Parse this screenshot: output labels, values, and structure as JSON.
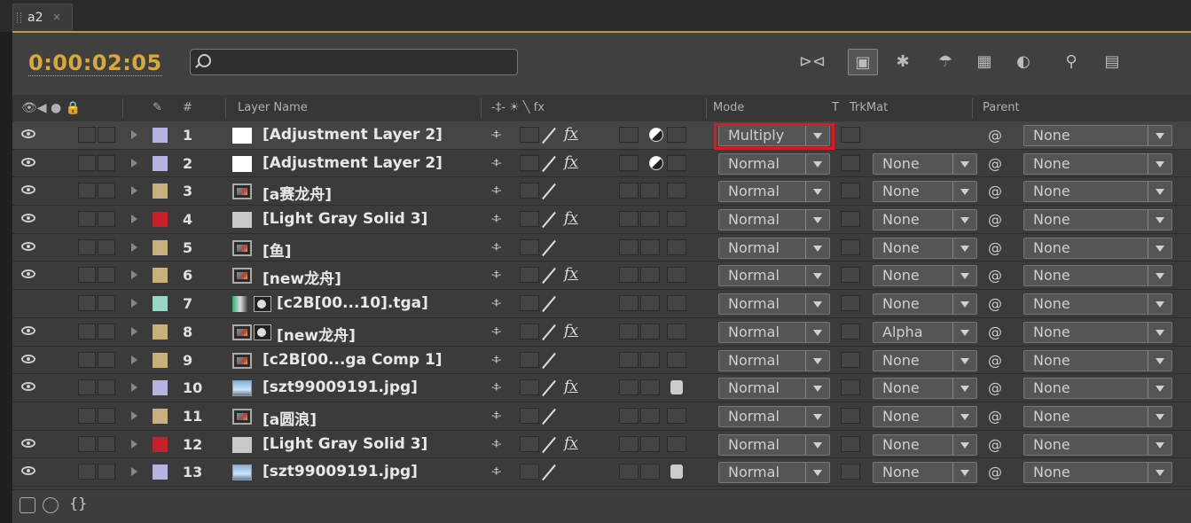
{
  "tab": {
    "name": "a2",
    "close": "×"
  },
  "toolbar": {
    "timecode": "0:00:02:05",
    "search_placeholder": ""
  },
  "header": {
    "layer_name": "Layer Name",
    "num": "#",
    "mode": "Mode",
    "t": "T",
    "trkmat": "TrkMat",
    "parent": "Parent",
    "switches_icons": "-‡- ☀ ╲ fx"
  },
  "layers": [
    {
      "num": "1",
      "name": "[Adjustment Layer 2]",
      "label_color": "#b5b4e0",
      "thumb": "white",
      "fx": true,
      "mode": "Multiply",
      "trkmat": "",
      "parent": "None"
    },
    {
      "num": "2",
      "name": "[Adjustment Layer 2]",
      "label_color": "#b5b4e0",
      "thumb": "white",
      "fx": true,
      "mode": "Normal",
      "trkmat": "None",
      "parent": "None"
    },
    {
      "num": "3",
      "name": "[a赛龙舟]",
      "label_color": "#c7b07c",
      "thumb": "comp",
      "fx": false,
      "mode": "Normal",
      "trkmat": "None",
      "parent": "None"
    },
    {
      "num": "4",
      "name": "[Light Gray Solid 3]",
      "label_color": "#c8202a",
      "thumb": "gray",
      "fx": true,
      "mode": "Normal",
      "trkmat": "None",
      "parent": "None"
    },
    {
      "num": "5",
      "name": "[鱼]",
      "label_color": "#c7b07c",
      "thumb": "comp",
      "fx": false,
      "mode": "Normal",
      "trkmat": "None",
      "parent": "None"
    },
    {
      "num": "6",
      "name": "[new龙舟]",
      "label_color": "#c7b07c",
      "thumb": "comp",
      "fx": true,
      "mode": "Normal",
      "trkmat": "None",
      "parent": "None"
    },
    {
      "num": "7",
      "name": "[c2B[00...10].tga]",
      "label_color": "#9bd6c4",
      "thumb": "seq",
      "fx": false,
      "mode": "Normal",
      "trkmat": "None",
      "parent": "None"
    },
    {
      "num": "8",
      "name": "[new龙舟]",
      "label_color": "#c7b07c",
      "thumb": "comp",
      "fx": true,
      "mode": "Normal",
      "trkmat": "Alpha",
      "parent": "None"
    },
    {
      "num": "9",
      "name": "[c2B[00...ga Comp 1]",
      "label_color": "#c7b07c",
      "thumb": "comp",
      "fx": false,
      "mode": "Normal",
      "trkmat": "None",
      "parent": "None"
    },
    {
      "num": "10",
      "name": "[szt99009191.jpg]",
      "label_color": "#b5b4e0",
      "thumb": "img",
      "fx": true,
      "mode": "Normal",
      "trkmat": "None",
      "parent": "None"
    },
    {
      "num": "11",
      "name": "[a圆浪]",
      "label_color": "#c7b07c",
      "thumb": "comp",
      "fx": false,
      "mode": "Normal",
      "trkmat": "None",
      "parent": "None"
    },
    {
      "num": "12",
      "name": "[Light Gray Solid 3]",
      "label_color": "#c8202a",
      "thumb": "gray",
      "fx": true,
      "mode": "Normal",
      "trkmat": "None",
      "parent": "None"
    },
    {
      "num": "13",
      "name": "[szt99009191.jpg]",
      "label_color": "#b5b4e0",
      "thumb": "img",
      "fx": false,
      "mode": "Normal",
      "trkmat": "None",
      "parent": "None"
    }
  ],
  "footer": {
    "braces": "{}"
  }
}
